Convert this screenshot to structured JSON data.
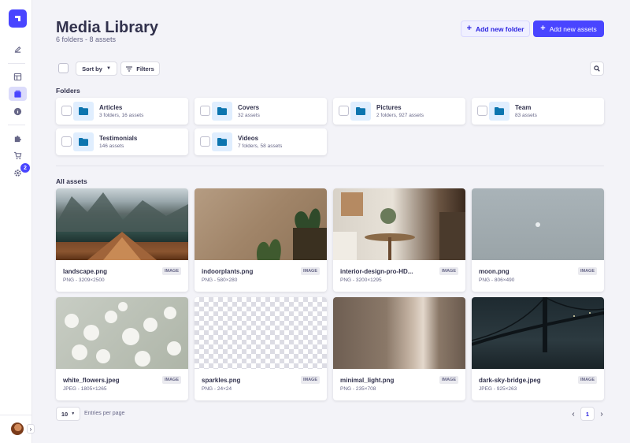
{
  "header": {
    "title": "Media Library",
    "subtitle": "6 folders - 8 assets",
    "add_folder_label": "Add new folder",
    "add_assets_label": "Add new assets"
  },
  "sidebar": {
    "notification_count": "2",
    "items": [
      {
        "icon": "pencil-icon"
      },
      {
        "icon": "layout-icon"
      },
      {
        "icon": "media-library-icon"
      },
      {
        "icon": "info-icon"
      },
      {
        "icon": "puzzle-icon"
      },
      {
        "icon": "cart-icon"
      },
      {
        "icon": "gear-icon"
      }
    ]
  },
  "toolbar": {
    "sort_label": "Sort by",
    "filters_label": "Filters"
  },
  "folders_section": {
    "label": "Folders",
    "items": [
      {
        "name": "Articles",
        "meta": "3 folders, 16 assets"
      },
      {
        "name": "Covers",
        "meta": "32 assets"
      },
      {
        "name": "Pictures",
        "meta": "2 folders, 927 assets"
      },
      {
        "name": "Team",
        "meta": "83 assets"
      },
      {
        "name": "Testimonials",
        "meta": "146 assets"
      },
      {
        "name": "Videos",
        "meta": "7 folders, 58 assets"
      }
    ]
  },
  "assets_section": {
    "label": "All assets",
    "items": [
      {
        "name": "landscape.png",
        "meta": "PNG - 3209×2500",
        "badge": "IMAGE"
      },
      {
        "name": "indoorplants.png",
        "meta": "PNG - 580×280",
        "badge": "IMAGE"
      },
      {
        "name": "interior-design-pro-HD...",
        "meta": "PNG - 3200×1295",
        "badge": "IMAGE"
      },
      {
        "name": "moon.png",
        "meta": "PNG - 806×490",
        "badge": "IMAGE"
      },
      {
        "name": "white_flowers.jpeg",
        "meta": "JPEG - 1805×1265",
        "badge": "IMAGE"
      },
      {
        "name": "sparkles.png",
        "meta": "PNG - 24×24",
        "badge": "IMAGE"
      },
      {
        "name": "minimal_light.png",
        "meta": "PNG - 235×708",
        "badge": "IMAGE"
      },
      {
        "name": "dark-sky-bridge.jpeg",
        "meta": "JPEG - 925×263",
        "badge": "IMAGE"
      }
    ]
  },
  "pagination": {
    "per_page_value": "10",
    "per_page_label": "Entries per page",
    "current_page": "1"
  },
  "colors": {
    "primary": "#4945ff",
    "background": "#f3f3f8",
    "text": "#32324d",
    "muted": "#666687"
  }
}
